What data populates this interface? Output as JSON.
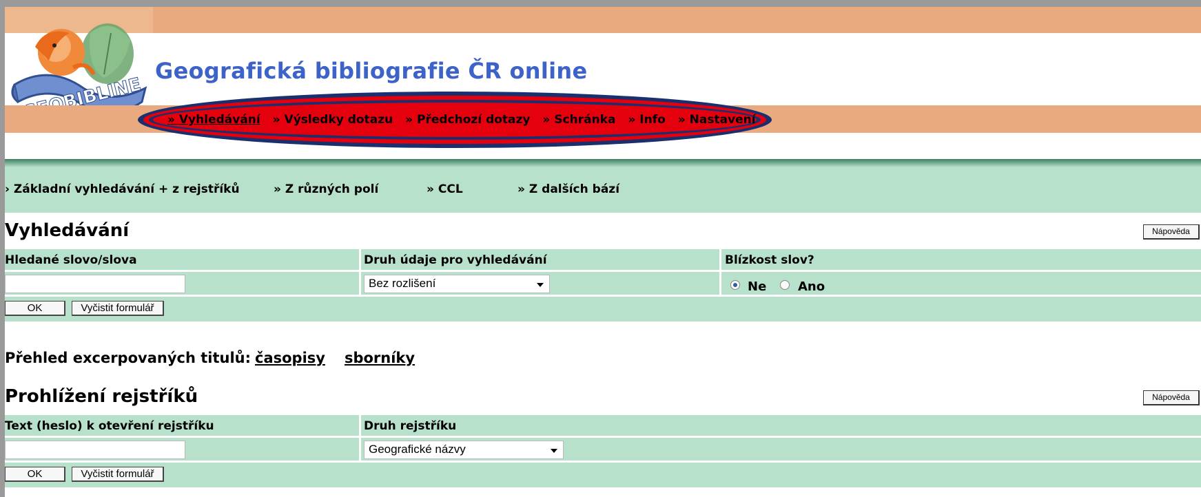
{
  "header": {
    "logo_text": "GEOBIBLINE",
    "site_title": "Geografická bibliografie ČR online",
    "nav": [
      {
        "label": "» Vyhledávání"
      },
      {
        "label": "» Výsledky dotazu"
      },
      {
        "label": "» Předchozí dotazy"
      },
      {
        "label": "» Schránka"
      },
      {
        "label": "» Info"
      },
      {
        "label": "» Nastavení"
      }
    ],
    "highlight_color": "#e5000e"
  },
  "search_tabs": [
    {
      "label": "› Základní vyhledávání + z rejstříků"
    },
    {
      "label": "» Z různých polí"
    },
    {
      "label": "» CCL"
    },
    {
      "label": "» Z dalších bází"
    }
  ],
  "search": {
    "title": "Vyhledávání",
    "help_label": "Nápověda",
    "col_word": "Hledané slovo/slova",
    "col_type": "Druh údaje pro vyhledávání",
    "col_proximity": "Blízkost slov?",
    "word_value": "",
    "type_selected": "Bez rozlišení",
    "radio_no": "Ne",
    "radio_yes": "Ano",
    "ok_label": "OK",
    "clear_label": "Vyčistit formulář"
  },
  "overview": {
    "prefix": "Přehled excerpovaných titulů:",
    "link_journals": "časopisy",
    "link_proceedings": "sborníky"
  },
  "browse": {
    "title": "Prohlížení rejstříků",
    "help_label": "Nápověda",
    "col_text": "Text (heslo) k otevření rejstříku",
    "col_index": "Druh rejstříku",
    "text_value": "",
    "index_selected": "Geografické názvy",
    "ok_label": "OK",
    "clear_label": "Vyčistit formulář"
  },
  "colors": {
    "header_band": "#e8aa7e",
    "title_blue": "#3d63c8",
    "table_green": "#b7e1cb"
  }
}
